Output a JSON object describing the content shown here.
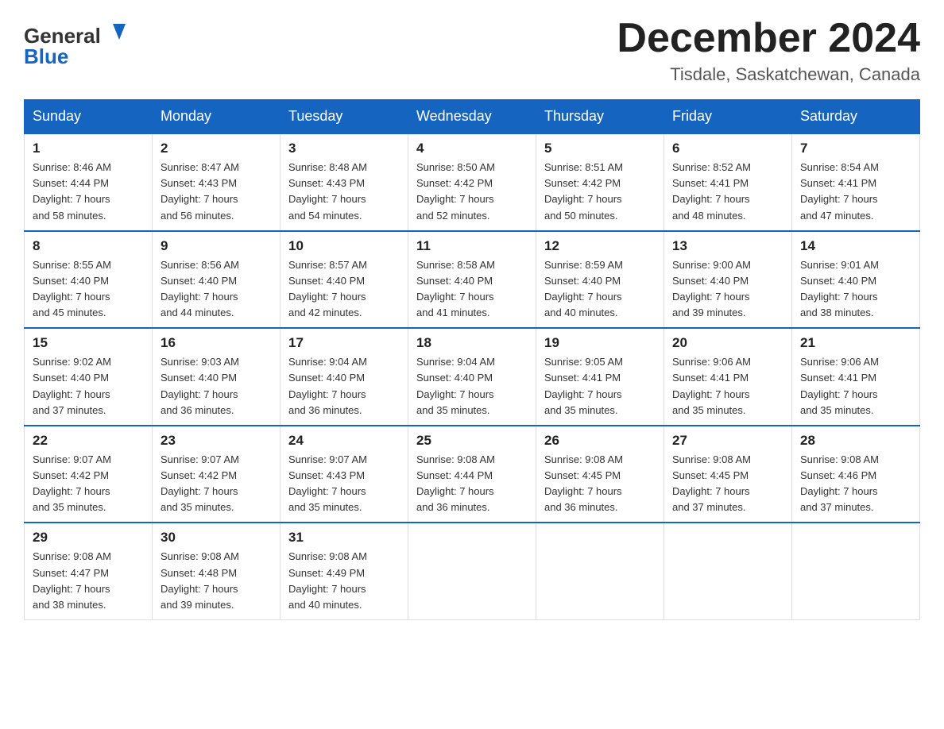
{
  "header": {
    "logo_general": "General",
    "logo_blue": "Blue",
    "month_title": "December 2024",
    "location": "Tisdale, Saskatchewan, Canada"
  },
  "weekdays": [
    "Sunday",
    "Monday",
    "Tuesday",
    "Wednesday",
    "Thursday",
    "Friday",
    "Saturday"
  ],
  "weeks": [
    [
      {
        "day": 1,
        "info": "Sunrise: 8:46 AM\nSunset: 4:44 PM\nDaylight: 7 hours\nand 58 minutes."
      },
      {
        "day": 2,
        "info": "Sunrise: 8:47 AM\nSunset: 4:43 PM\nDaylight: 7 hours\nand 56 minutes."
      },
      {
        "day": 3,
        "info": "Sunrise: 8:48 AM\nSunset: 4:43 PM\nDaylight: 7 hours\nand 54 minutes."
      },
      {
        "day": 4,
        "info": "Sunrise: 8:50 AM\nSunset: 4:42 PM\nDaylight: 7 hours\nand 52 minutes."
      },
      {
        "day": 5,
        "info": "Sunrise: 8:51 AM\nSunset: 4:42 PM\nDaylight: 7 hours\nand 50 minutes."
      },
      {
        "day": 6,
        "info": "Sunrise: 8:52 AM\nSunset: 4:41 PM\nDaylight: 7 hours\nand 48 minutes."
      },
      {
        "day": 7,
        "info": "Sunrise: 8:54 AM\nSunset: 4:41 PM\nDaylight: 7 hours\nand 47 minutes."
      }
    ],
    [
      {
        "day": 8,
        "info": "Sunrise: 8:55 AM\nSunset: 4:40 PM\nDaylight: 7 hours\nand 45 minutes."
      },
      {
        "day": 9,
        "info": "Sunrise: 8:56 AM\nSunset: 4:40 PM\nDaylight: 7 hours\nand 44 minutes."
      },
      {
        "day": 10,
        "info": "Sunrise: 8:57 AM\nSunset: 4:40 PM\nDaylight: 7 hours\nand 42 minutes."
      },
      {
        "day": 11,
        "info": "Sunrise: 8:58 AM\nSunset: 4:40 PM\nDaylight: 7 hours\nand 41 minutes."
      },
      {
        "day": 12,
        "info": "Sunrise: 8:59 AM\nSunset: 4:40 PM\nDaylight: 7 hours\nand 40 minutes."
      },
      {
        "day": 13,
        "info": "Sunrise: 9:00 AM\nSunset: 4:40 PM\nDaylight: 7 hours\nand 39 minutes."
      },
      {
        "day": 14,
        "info": "Sunrise: 9:01 AM\nSunset: 4:40 PM\nDaylight: 7 hours\nand 38 minutes."
      }
    ],
    [
      {
        "day": 15,
        "info": "Sunrise: 9:02 AM\nSunset: 4:40 PM\nDaylight: 7 hours\nand 37 minutes."
      },
      {
        "day": 16,
        "info": "Sunrise: 9:03 AM\nSunset: 4:40 PM\nDaylight: 7 hours\nand 36 minutes."
      },
      {
        "day": 17,
        "info": "Sunrise: 9:04 AM\nSunset: 4:40 PM\nDaylight: 7 hours\nand 36 minutes."
      },
      {
        "day": 18,
        "info": "Sunrise: 9:04 AM\nSunset: 4:40 PM\nDaylight: 7 hours\nand 35 minutes."
      },
      {
        "day": 19,
        "info": "Sunrise: 9:05 AM\nSunset: 4:41 PM\nDaylight: 7 hours\nand 35 minutes."
      },
      {
        "day": 20,
        "info": "Sunrise: 9:06 AM\nSunset: 4:41 PM\nDaylight: 7 hours\nand 35 minutes."
      },
      {
        "day": 21,
        "info": "Sunrise: 9:06 AM\nSunset: 4:41 PM\nDaylight: 7 hours\nand 35 minutes."
      }
    ],
    [
      {
        "day": 22,
        "info": "Sunrise: 9:07 AM\nSunset: 4:42 PM\nDaylight: 7 hours\nand 35 minutes."
      },
      {
        "day": 23,
        "info": "Sunrise: 9:07 AM\nSunset: 4:42 PM\nDaylight: 7 hours\nand 35 minutes."
      },
      {
        "day": 24,
        "info": "Sunrise: 9:07 AM\nSunset: 4:43 PM\nDaylight: 7 hours\nand 35 minutes."
      },
      {
        "day": 25,
        "info": "Sunrise: 9:08 AM\nSunset: 4:44 PM\nDaylight: 7 hours\nand 36 minutes."
      },
      {
        "day": 26,
        "info": "Sunrise: 9:08 AM\nSunset: 4:45 PM\nDaylight: 7 hours\nand 36 minutes."
      },
      {
        "day": 27,
        "info": "Sunrise: 9:08 AM\nSunset: 4:45 PM\nDaylight: 7 hours\nand 37 minutes."
      },
      {
        "day": 28,
        "info": "Sunrise: 9:08 AM\nSunset: 4:46 PM\nDaylight: 7 hours\nand 37 minutes."
      }
    ],
    [
      {
        "day": 29,
        "info": "Sunrise: 9:08 AM\nSunset: 4:47 PM\nDaylight: 7 hours\nand 38 minutes."
      },
      {
        "day": 30,
        "info": "Sunrise: 9:08 AM\nSunset: 4:48 PM\nDaylight: 7 hours\nand 39 minutes."
      },
      {
        "day": 31,
        "info": "Sunrise: 9:08 AM\nSunset: 4:49 PM\nDaylight: 7 hours\nand 40 minutes."
      },
      null,
      null,
      null,
      null
    ]
  ]
}
